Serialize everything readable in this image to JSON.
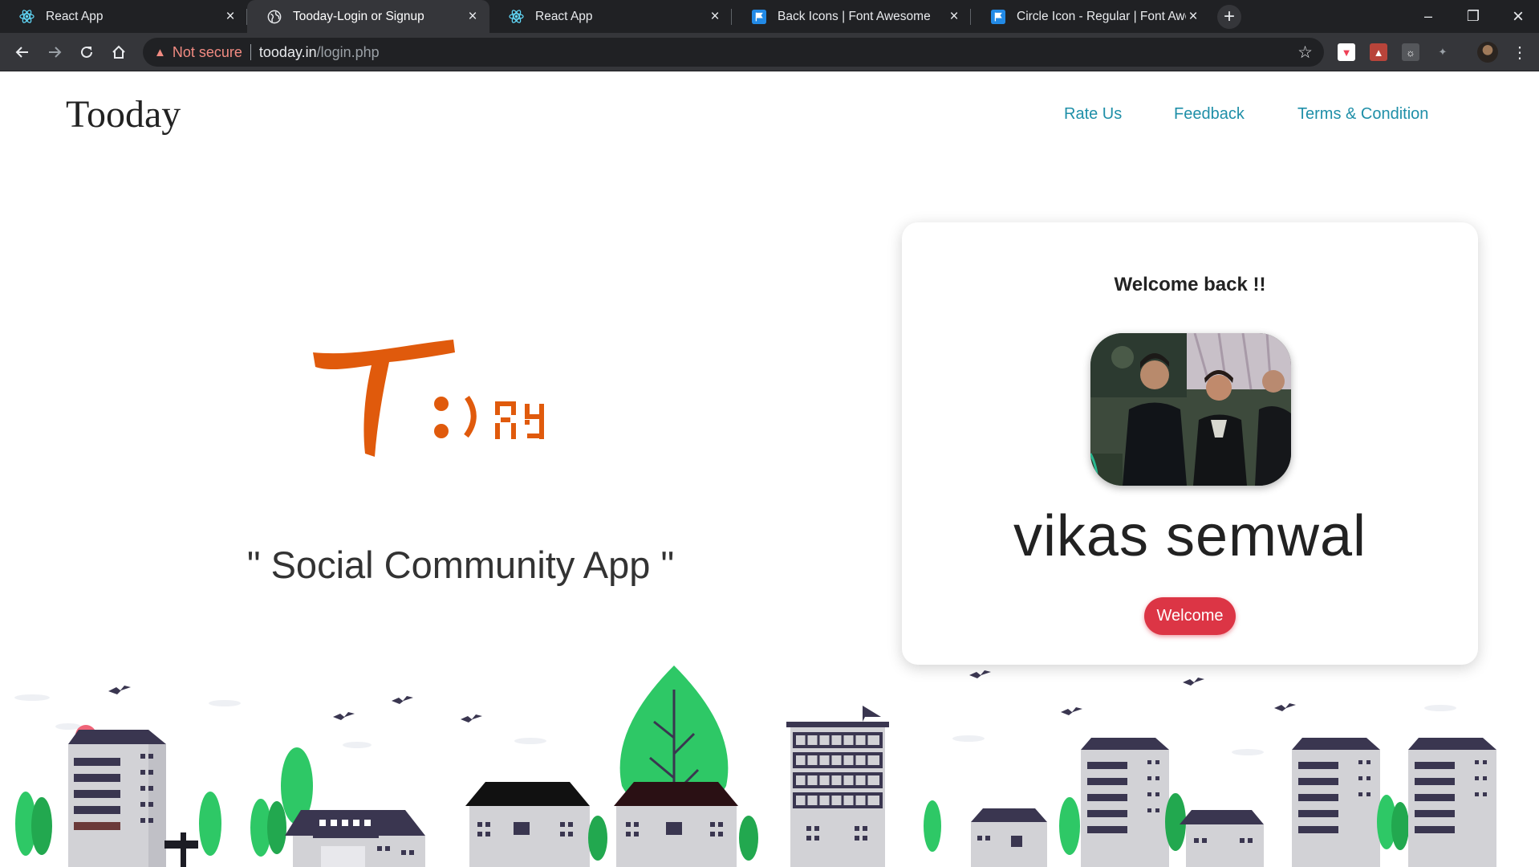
{
  "browser": {
    "tabs": [
      {
        "title": "React App",
        "icon": "react-icon"
      },
      {
        "title": "Tooday-Login or Signup",
        "icon": "globe-icon"
      },
      {
        "title": "React App",
        "icon": "react-icon"
      },
      {
        "title": "Back Icons | Font Awesome",
        "icon": "flag-icon"
      },
      {
        "title": "Circle Icon - Regular | Font Awesome",
        "icon": "flag-icon"
      }
    ],
    "address": {
      "security_label": "Not secure",
      "url_host": "tooday.in",
      "url_path": "/login.php"
    }
  },
  "header": {
    "brand": "Tooday",
    "nav": [
      "Rate Us",
      "Feedback",
      "Terms & Condition"
    ]
  },
  "hero": {
    "tagline": "\" Social Community App \"",
    "logo_text": "T:)AY"
  },
  "login_card": {
    "heading": "Welcome back !!",
    "username": "vikas semwal",
    "button_label": "Welcome"
  },
  "colors": {
    "logo_orange": "#e05a0c",
    "nav_link": "#1f8fa8",
    "button_red": "#dc3545",
    "tree_green": "#2ec866",
    "building_dark": "#3a3650"
  }
}
